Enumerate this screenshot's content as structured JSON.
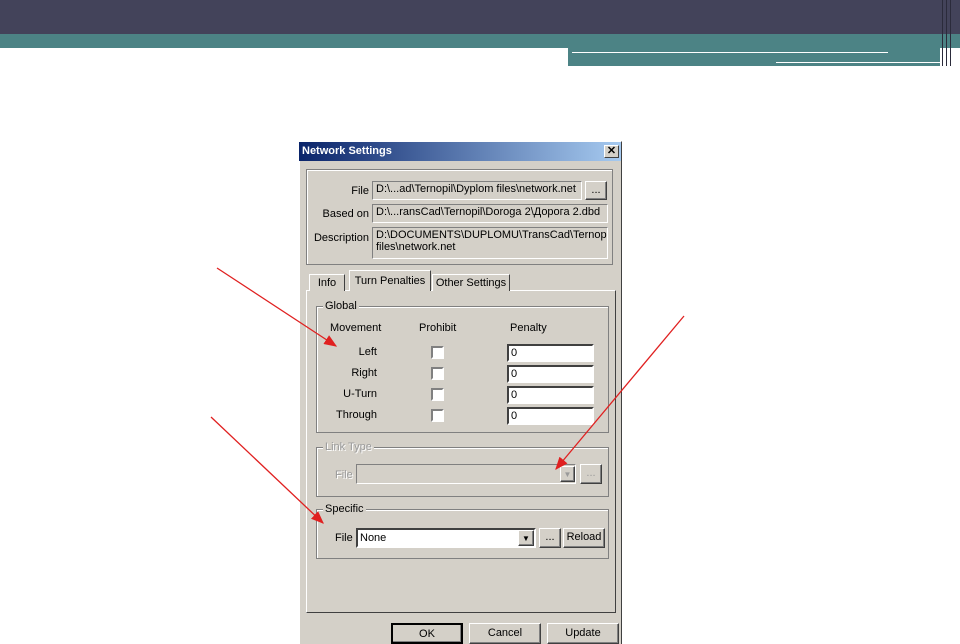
{
  "dialog": {
    "title": "Network Settings",
    "close_glyph": "✕",
    "file_label": "File",
    "file_value": "D:\\...ad\\Ternopil\\Dyplom files\\network.net",
    "browse_label": "...",
    "based_on_label": "Based on",
    "based_on_value": "D:\\...ransCad\\Ternopil\\Doroga 2\\Дорога 2.dbd",
    "description_label": "Description",
    "description_line1": "D:\\DOCUMENTS\\DUPLOMU\\TransCad\\Ternop",
    "description_line2": "files\\network.net"
  },
  "tabs": [
    {
      "label": "Info"
    },
    {
      "label": "Turn Penalties"
    },
    {
      "label": "Other Settings"
    }
  ],
  "global": {
    "title": "Global",
    "col_movement": "Movement",
    "col_prohibit": "Prohibit",
    "col_penalty": "Penalty",
    "rows": [
      {
        "movement": "Left",
        "penalty": "0"
      },
      {
        "movement": "Right",
        "penalty": "0"
      },
      {
        "movement": "U-Turn",
        "penalty": "0"
      },
      {
        "movement": "Through",
        "penalty": "0"
      }
    ]
  },
  "link_type": {
    "title": "Link Type",
    "file_label": "File",
    "browse_label": "..."
  },
  "specific": {
    "title": "Specific",
    "file_label": "File",
    "file_value": "None",
    "browse_label": "...",
    "reload_label": "Reload"
  },
  "buttons": {
    "ok": "OK",
    "cancel": "Cancel",
    "update": "Update"
  },
  "colors": {
    "header_dark": "#43435a",
    "header_teal": "#4c8385",
    "dialog_face": "#d4d0c8",
    "arrow": "#e02020"
  }
}
